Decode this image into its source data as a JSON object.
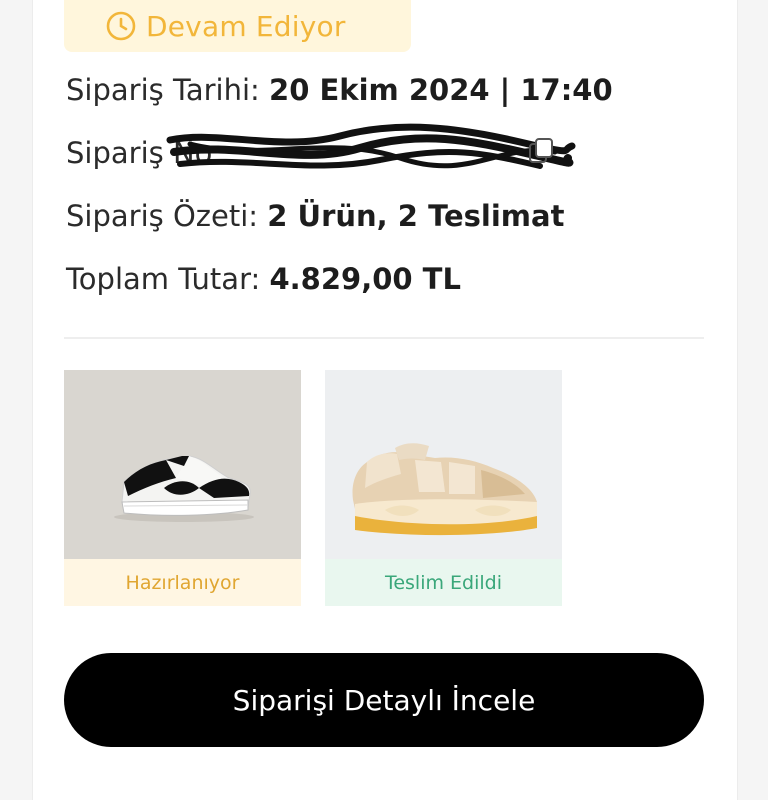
{
  "status": {
    "label": "Devam Ediyor",
    "icon": "clock-icon",
    "color": "#f2b63a"
  },
  "order": {
    "date_label": "Sipariş Tarihi:",
    "date_value": "20 Ekim 2024 | 17:40",
    "number_label": "Sipariş No:",
    "number_value": "",
    "summary_label": "Sipariş Özeti:",
    "summary_value": "2 Ürün, 2 Teslimat",
    "total_label": "Toplam Tutar:",
    "total_value": "4.829,00 TL"
  },
  "products": [
    {
      "status": "Hazırlanıyor",
      "status_color": "#e0a631",
      "icon": "sneaker-black-white"
    },
    {
      "status": "Teslim Edildi",
      "status_color": "#3aa77a",
      "icon": "sneaker-beige"
    }
  ],
  "actions": {
    "detail_button": "Siparişi Detaylı İncele"
  }
}
